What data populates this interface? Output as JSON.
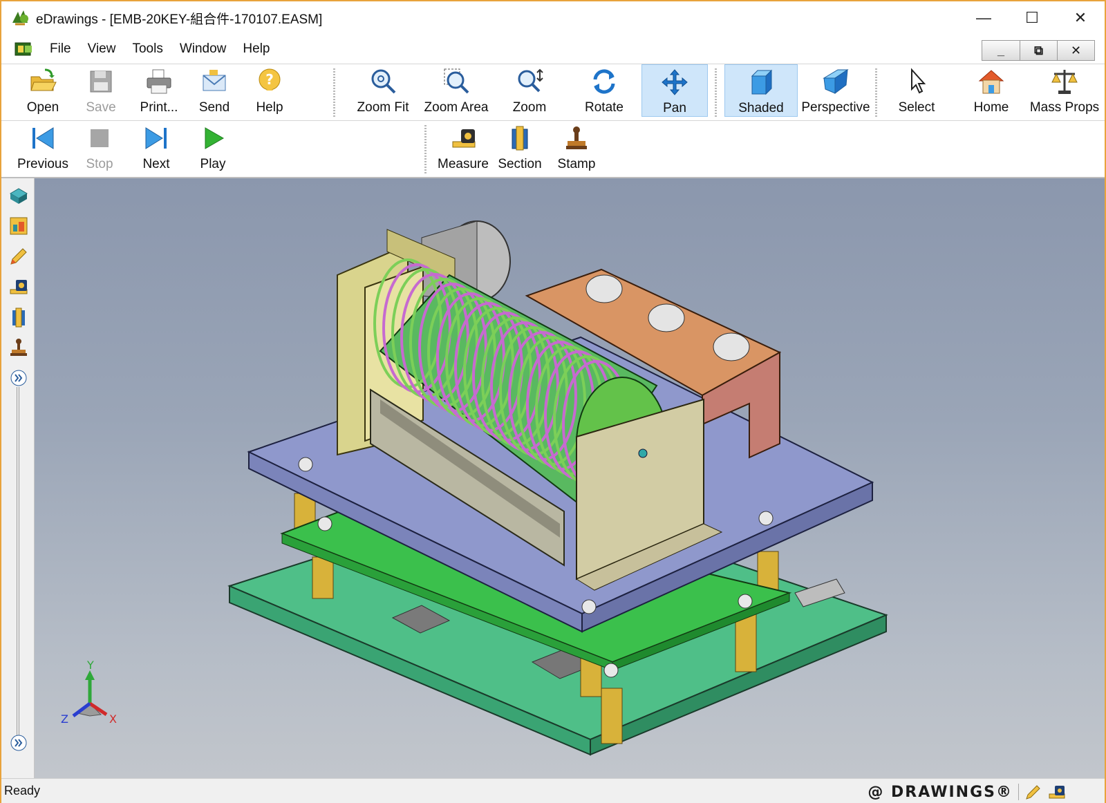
{
  "window": {
    "title": "eDrawings - [EMB-20KEY-組合件-170107.EASM]",
    "controls": {
      "minimize": "—",
      "maximize": "☐",
      "close": "✕"
    }
  },
  "menu": {
    "items": [
      "File",
      "View",
      "Tools",
      "Window",
      "Help"
    ],
    "mdi": {
      "minimize": "_",
      "restore": "⧉",
      "close": "✕"
    }
  },
  "toolbar1": {
    "buttons": [
      {
        "label": "Open",
        "icon": "open-folder-icon",
        "state": "enabled"
      },
      {
        "label": "Save",
        "icon": "save-disk-icon",
        "state": "disabled"
      },
      {
        "label": "Print...",
        "icon": "printer-icon",
        "state": "enabled"
      },
      {
        "label": "Send",
        "icon": "envelope-icon",
        "state": "enabled"
      },
      {
        "label": "Help",
        "icon": "help-icon",
        "state": "enabled"
      },
      {
        "label": "Zoom Fit",
        "icon": "zoom-fit-icon",
        "state": "enabled"
      },
      {
        "label": "Zoom Area",
        "icon": "zoom-area-icon",
        "state": "enabled"
      },
      {
        "label": "Zoom",
        "icon": "zoom-icon",
        "state": "enabled"
      },
      {
        "label": "Rotate",
        "icon": "rotate-icon",
        "state": "enabled"
      },
      {
        "label": "Pan",
        "icon": "pan-icon",
        "state": "active"
      },
      {
        "label": "Shaded",
        "icon": "shaded-cube-icon",
        "state": "active"
      },
      {
        "label": "Perspective",
        "icon": "perspective-icon",
        "state": "enabled"
      },
      {
        "label": "Select",
        "icon": "select-arrow-icon",
        "state": "enabled"
      },
      {
        "label": "Home",
        "icon": "home-icon",
        "state": "enabled"
      },
      {
        "label": "Mass Props",
        "icon": "mass-props-icon",
        "state": "enabled"
      }
    ]
  },
  "toolbar2": {
    "buttons": [
      {
        "label": "Previous",
        "icon": "previous-icon",
        "state": "enabled"
      },
      {
        "label": "Stop",
        "icon": "stop-icon",
        "state": "disabled"
      },
      {
        "label": "Next",
        "icon": "next-icon",
        "state": "enabled"
      },
      {
        "label": "Play",
        "icon": "play-icon",
        "state": "enabled"
      },
      {
        "label": "Measure",
        "icon": "measure-tape-icon",
        "state": "enabled"
      },
      {
        "label": "Section",
        "icon": "section-icon",
        "state": "enabled"
      },
      {
        "label": "Stamp",
        "icon": "stamp-icon",
        "state": "enabled"
      }
    ]
  },
  "sidebar": {
    "buttons": [
      "components-icon",
      "configurations-icon",
      "markup-pencil-icon",
      "measure-tape-icon",
      "section-icon",
      "stamp-icon",
      "expand-chevron-icon"
    ],
    "bottom": "expand-chevron-icon"
  },
  "triad": {
    "x": "X",
    "y": "Y",
    "z": "Z"
  },
  "status": {
    "text": "Ready",
    "brand": "@ DRAWINGS®"
  }
}
